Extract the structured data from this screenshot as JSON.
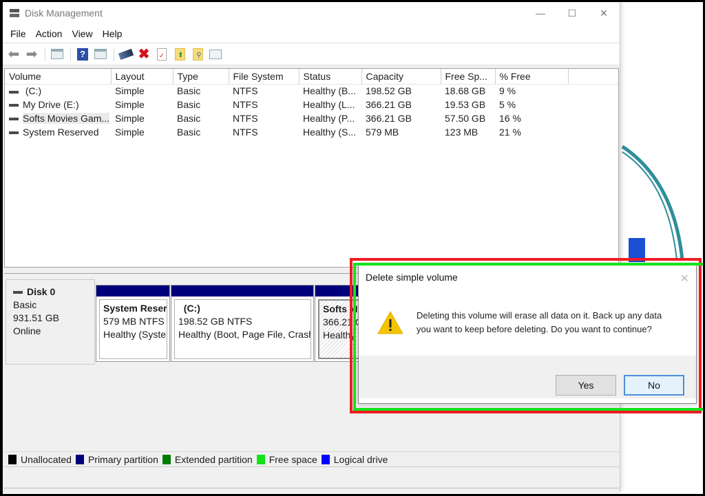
{
  "window": {
    "title": "Disk Management",
    "controls": {
      "minimize": "—",
      "maximize": "☐",
      "close": "✕"
    }
  },
  "menu": [
    "File",
    "Action",
    "View",
    "Help"
  ],
  "toolbar": {
    "icons": [
      "back-icon",
      "forward-icon",
      "show-hide-console-tree-icon",
      "help-icon",
      "show-action-pane-icon",
      "connect-disk-icon",
      "delete-icon",
      "properties-icon",
      "export-list-icon",
      "rescan-disks-icon",
      "settings-icon"
    ]
  },
  "volume_table": {
    "columns": [
      "Volume",
      "Layout",
      "Type",
      "File System",
      "Status",
      "Capacity",
      "Free Sp...",
      "% Free"
    ],
    "rows": [
      {
        "volume": " (C:)",
        "layout": "Simple",
        "type": "Basic",
        "fs": "NTFS",
        "status": "Healthy (B...",
        "capacity": "198.52 GB",
        "free": "18.68 GB",
        "pct": "9 %"
      },
      {
        "volume": "My Drive (E:)",
        "layout": "Simple",
        "type": "Basic",
        "fs": "NTFS",
        "status": "Healthy (L...",
        "capacity": "366.21 GB",
        "free": "19.53 GB",
        "pct": "5 %"
      },
      {
        "volume": "Softs Movies Gam...",
        "layout": "Simple",
        "type": "Basic",
        "fs": "NTFS",
        "status": "Healthy (P...",
        "capacity": "366.21 GB",
        "free": "57.50 GB",
        "pct": "16 %"
      },
      {
        "volume": "System Reserved",
        "layout": "Simple",
        "type": "Basic",
        "fs": "NTFS",
        "status": "Healthy (S...",
        "capacity": "579 MB",
        "free": "123 MB",
        "pct": "21 %"
      }
    ]
  },
  "disk": {
    "name": "Disk 0",
    "type": "Basic",
    "size": "931.51 GB",
    "state": "Online",
    "partitions": [
      {
        "name": "System Reser",
        "size": "579 MB NTFS",
        "status": "Healthy (Syste"
      },
      {
        "name": "  (C:)",
        "size": "198.52 GB NTFS",
        "status": "Healthy (Boot, Page File, Crash"
      },
      {
        "name": "Softs Mo",
        "size": "366.21 GB",
        "status": "Healthy ("
      }
    ]
  },
  "legend": [
    {
      "label": "Unallocated",
      "color": "#000000"
    },
    {
      "label": "Primary partition",
      "color": "#00007c"
    },
    {
      "label": "Extended partition",
      "color": "#007c00"
    },
    {
      "label": "Free space",
      "color": "#13e41a"
    },
    {
      "label": "Logical drive",
      "color": "#0000ff"
    }
  ],
  "dialog": {
    "title": "Delete simple volume",
    "message": "Deleting this volume will erase all data on it. Back up any data you want to keep before deleting. Do you want to continue?",
    "yes_label": "Yes",
    "no_label": "No",
    "close": "✕"
  },
  "colors": {
    "primary_partition": "#00007c",
    "annotation_red": "#ee1d23",
    "annotation_green": "#13e41a",
    "warning": "#f5c400"
  }
}
